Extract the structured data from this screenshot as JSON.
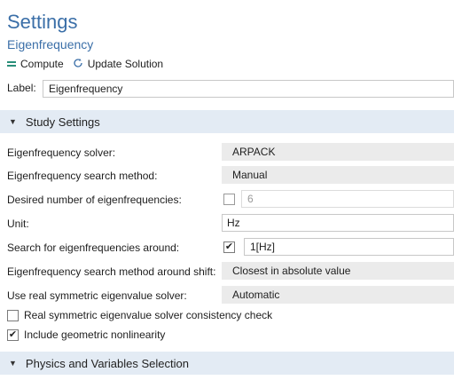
{
  "header": {
    "title": "Settings",
    "subtitle": "Eigenfrequency"
  },
  "toolbar": {
    "compute_label": "Compute",
    "update_label": "Update Solution"
  },
  "label_field": {
    "label": "Label:",
    "value": "Eigenfrequency"
  },
  "study_settings": {
    "heading": "Study Settings",
    "solver_label": "Eigenfrequency solver:",
    "solver_value": "ARPACK",
    "search_method_label": "Eigenfrequency search method:",
    "search_method_value": "Manual",
    "desired_number_label": "Desired number of eigenfrequencies:",
    "desired_number_checked": false,
    "desired_number_value": "6",
    "unit_label": "Unit:",
    "unit_value": "Hz",
    "search_around_label": "Search for eigenfrequencies around:",
    "search_around_checked": true,
    "search_around_value": "1[Hz]",
    "shift_method_label": "Eigenfrequency search method around shift:",
    "shift_method_value": "Closest in absolute value",
    "real_symmetric_label": "Use real symmetric eigenvalue solver:",
    "real_symmetric_value": "Automatic",
    "consistency_check_label": "Real symmetric eigenvalue solver consistency check",
    "consistency_check_checked": false,
    "geometric_nonlinearity_label": "Include geometric nonlinearity",
    "geometric_nonlinearity_checked": true
  },
  "physics_section": {
    "heading": "Physics and Variables Selection"
  },
  "colors": {
    "accent": "#3b6fa8",
    "section_bg": "#e3ebf4",
    "select_bg": "#ebebeb"
  },
  "icons": {
    "compute": "equals-icon",
    "update": "refresh-icon",
    "collapse": "triangle-down-icon",
    "check": "check-icon"
  }
}
